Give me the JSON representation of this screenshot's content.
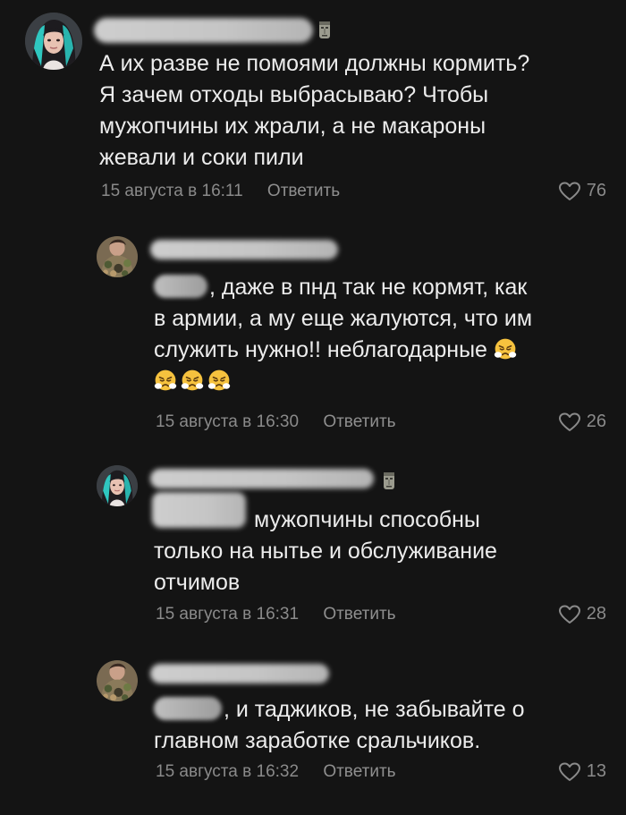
{
  "comments": [
    {
      "text": [
        "А их разве не помоями должны кормить?",
        "Я зачем отходы выбрасываю? Чтобы",
        "мужопчины их жрали, а не макароны",
        "жевали и соки пили"
      ],
      "date": "15 августа в 16:11",
      "reply_label": "Ответить",
      "likes": "76",
      "avatar": "avatar-girl-teal-hair-icon",
      "badge": "moai-icon"
    },
    {
      "text": [
        ", даже в пнд так не кормят, как",
        "в армии, а му еще жалуются, что им",
        "служить нужно!! неблагодарные"
      ],
      "date": "15 августа в 16:30",
      "reply_label": "Ответить",
      "likes": "26",
      "avatar": "avatar-camouflage-icon",
      "emoji": "face-with-steam-from-nose-emoji"
    },
    {
      "text": [
        "мужопчины способны",
        "только на нытье и обслуживание",
        "отчимов"
      ],
      "date": "15 августа в 16:31",
      "reply_label": "Ответить",
      "likes": "28",
      "avatar": "avatar-girl-teal-hair-icon",
      "badge": "moai-icon"
    },
    {
      "text": [
        ", и таджиков, не забывайте о",
        "главном заработке сральчиков."
      ],
      "date": "15 августа в 16:32",
      "reply_label": "Ответить",
      "likes": "13",
      "avatar": "avatar-camouflage-icon"
    }
  ],
  "colors": {
    "background": "#141414",
    "text": "#ececec",
    "meta": "#8a8a8a"
  }
}
